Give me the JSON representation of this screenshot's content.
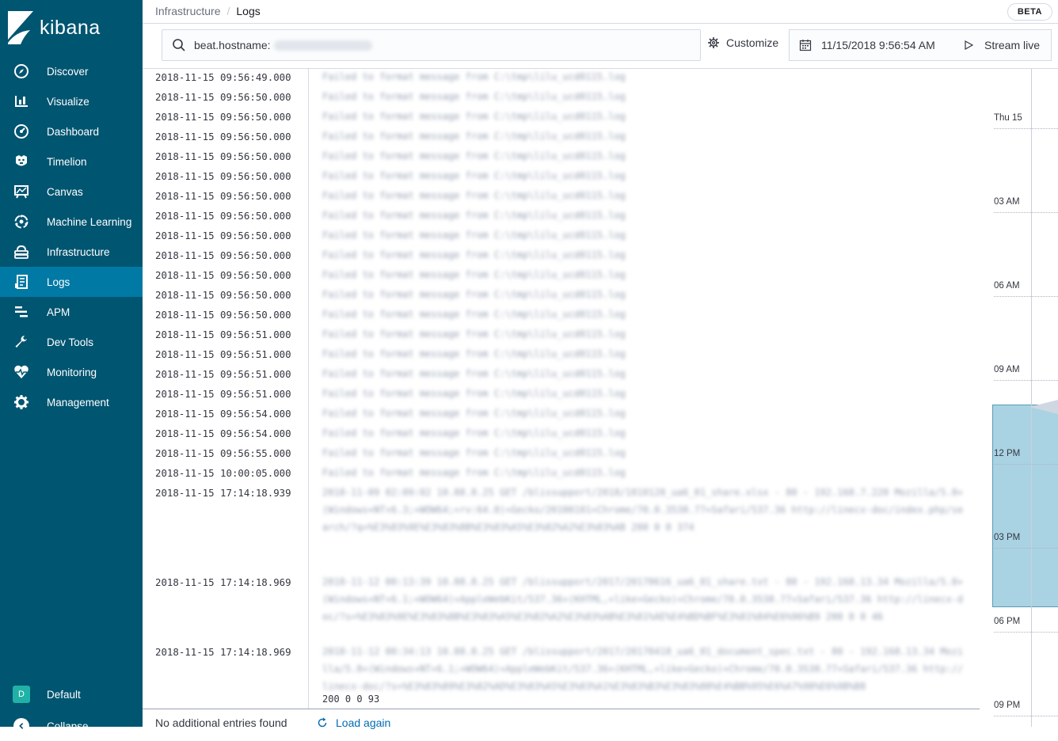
{
  "app": {
    "logo_text": "kibana"
  },
  "nav": {
    "items": [
      {
        "label": "Discover",
        "icon": "compass-icon"
      },
      {
        "label": "Visualize",
        "icon": "bar-chart-icon"
      },
      {
        "label": "Dashboard",
        "icon": "dashboard-icon"
      },
      {
        "label": "Timelion",
        "icon": "timelion-icon"
      },
      {
        "label": "Canvas",
        "icon": "canvas-icon"
      },
      {
        "label": "Machine Learning",
        "icon": "machine-learning-icon"
      },
      {
        "label": "Infrastructure",
        "icon": "infrastructure-icon"
      },
      {
        "label": "Logs",
        "icon": "logs-icon",
        "active": true
      },
      {
        "label": "APM",
        "icon": "apm-icon"
      },
      {
        "label": "Dev Tools",
        "icon": "wrench-icon"
      },
      {
        "label": "Monitoring",
        "icon": "heartbeat-icon"
      },
      {
        "label": "Management",
        "icon": "gear-icon"
      }
    ],
    "space_label": "Default",
    "space_initial": "D",
    "collapse_label": "Collapse"
  },
  "breadcrumb": {
    "parent": "Infrastructure",
    "separator": "/",
    "current": "Logs"
  },
  "badge": "BETA",
  "toolbar": {
    "search_prefix": "beat.hostname:",
    "customize_label": "Customize",
    "date": "11/15/2018 9:56:54 AM",
    "stream_label": "Stream live"
  },
  "logs": {
    "rows": [
      {
        "ts": "2018-11-15 09:56:49.000",
        "msg": "Failed to format message from C:\\tmp\\lilu_ucd0115.log"
      },
      {
        "ts": "2018-11-15 09:56:50.000",
        "msg": "Failed to format message from C:\\tmp\\lilu_ucd0115.log"
      },
      {
        "ts": "2018-11-15 09:56:50.000",
        "msg": "Failed to format message from C:\\tmp\\lilu_ucd0115.log"
      },
      {
        "ts": "2018-11-15 09:56:50.000",
        "msg": "Failed to format message from C:\\tmp\\lilu_ucd0115.log"
      },
      {
        "ts": "2018-11-15 09:56:50.000",
        "msg": "Failed to format message from C:\\tmp\\lilu_ucd0115.log"
      },
      {
        "ts": "2018-11-15 09:56:50.000",
        "msg": "Failed to format message from C:\\tmp\\lilu_ucd0115.log"
      },
      {
        "ts": "2018-11-15 09:56:50.000",
        "msg": "Failed to format message from C:\\tmp\\lilu_ucd0115.log"
      },
      {
        "ts": "2018-11-15 09:56:50.000",
        "msg": "Failed to format message from C:\\tmp\\lilu_ucd0115.log"
      },
      {
        "ts": "2018-11-15 09:56:50.000",
        "msg": "Failed to format message from C:\\tmp\\lilu_ucd0115.log"
      },
      {
        "ts": "2018-11-15 09:56:50.000",
        "msg": "Failed to format message from C:\\tmp\\lilu_ucd0115.log"
      },
      {
        "ts": "2018-11-15 09:56:50.000",
        "msg": "Failed to format message from C:\\tmp\\lilu_ucd0115.log"
      },
      {
        "ts": "2018-11-15 09:56:50.000",
        "msg": "Failed to format message from C:\\tmp\\lilu_ucd0115.log"
      },
      {
        "ts": "2018-11-15 09:56:50.000",
        "msg": "Failed to format message from C:\\tmp\\lilu_ucd0115.log"
      },
      {
        "ts": "2018-11-15 09:56:51.000",
        "msg": "Failed to format message from C:\\tmp\\lilu_ucd0115.log"
      },
      {
        "ts": "2018-11-15 09:56:51.000",
        "msg": "Failed to format message from C:\\tmp\\lilu_ucd0115.log"
      },
      {
        "ts": "2018-11-15 09:56:51.000",
        "msg": "Failed to format message from C:\\tmp\\lilu_ucd0115.log"
      },
      {
        "ts": "2018-11-15 09:56:51.000",
        "msg": "Failed to format message from C:\\tmp\\lilu_ucd0115.log"
      },
      {
        "ts": "2018-11-15 09:56:54.000",
        "msg": "Failed to format message from C:\\tmp\\lilu_ucd0115.log"
      },
      {
        "ts": "2018-11-15 09:56:54.000",
        "msg": "Failed to format message from C:\\tmp\\lilu_ucd0115.log"
      },
      {
        "ts": "2018-11-15 09:56:55.000",
        "msg": "Failed to format message from C:\\tmp\\lilu_ucd0115.log"
      },
      {
        "ts": "2018-11-15 10:00:05.000",
        "msg": "Failed to format message from C:\\tmp\\lilu_ucd0115.log"
      }
    ],
    "multi_rows": [
      {
        "ts": "2018-11-15 17:14:18.939",
        "msg": "2018-11-09 02:09:02 10.88.8.25 GET /blissupport/2018/1810120_ua6_01_share.xlsx - 80 - 192.168.7.220 Mozilla/5.0+(Windows+NT+6.3;+WOW64;+rv:64.0)+Gecko/20100101+Chrome/70.0.3538.77+Safari/537.36 http://linecx-doc/index.php/search/?q=%E3%83%9E%E3%83%8B%E3%83%A5%E3%82%A2%E3%83%AB 200 0 0 374"
      },
      {
        "ts": "2018-11-15 17:14:18.969",
        "msg": "2018-11-12 00:13:39 10.88.8.25 GET /blissupport/2017/20170616_ua6_01_share.txt - 80 - 192.168.13.34 Mozilla/5.0+(Windows+NT+6.1;+WOW64)+AppleWebKit/537.36+(KHTML,+like+Gecko)+Chrome/70.0.3538.77+Safari/537.36 http://linecx-doc/?s=%E3%83%9E%E3%83%8B%E3%83%A5%E3%82%A2%E3%83%AB%E3%81%AE%E4%BD%BF%E3%81%84%E6%96%B9 200 0 0 46"
      },
      {
        "ts": "2018-11-15 17:14:18.969",
        "msg": "2018-11-12 00:34:13 10.88.8.25 GET /blissupport/2017/20170418_ua6_01_document_spec.txt - 80 - 192.168.13.34 Mozilla/5.0+(Windows+NT+6.1;+WOW64)+AppleWebKit/537.36+(KHTML,+like+Gecko)+Chrome/70.0.3538.77+Safari/537.36 http://linecx-doc/?s=%E3%83%89%E3%82%AD%E3%83%A5%E3%83%A1%E3%83%B3%E3%83%88%E4%BB%95%E6%A7%98%E6%9B%B8",
        "tail": "200 0 0 93"
      }
    ]
  },
  "footer": {
    "status": "No additional entries found",
    "load_again": "Load again"
  },
  "minimap": {
    "ticks": [
      "Thu 15",
      "03 AM",
      "06 AM",
      "09 AM",
      "12 PM",
      "03 PM",
      "06 PM",
      "09 PM"
    ]
  },
  "colors": {
    "sidebar": "#005571",
    "active_nav": "#0079a5",
    "link": "#006bb4",
    "highlight": "#a9d3e3"
  }
}
